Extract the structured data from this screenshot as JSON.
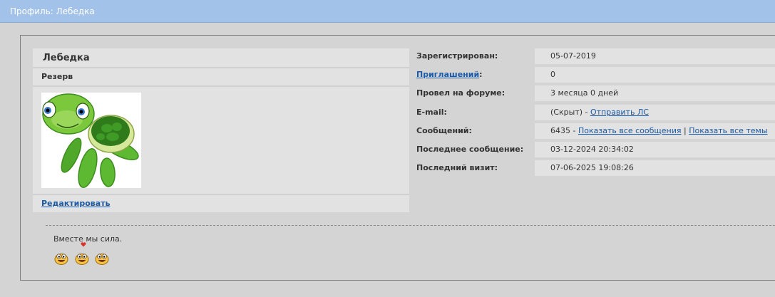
{
  "titlebar": {
    "title": "Профиль: Лебедка"
  },
  "profile": {
    "name": "Лебедка",
    "status": "Резерв",
    "edit_label": "Редактировать"
  },
  "stats": {
    "registered": {
      "label": "Зарегистрирован:",
      "value": "05-07-2019"
    },
    "invitations": {
      "label": "Приглашений",
      "colon": ":",
      "value": "0"
    },
    "time_on_forum": {
      "label": "Провел на форуме:",
      "value": "3 месяца 0 дней"
    },
    "email": {
      "label": "E-mail:",
      "value": "(Скрыт) - ",
      "send_pm": "Отправить ЛС"
    },
    "posts": {
      "label": "Сообщений:",
      "value": "6435 - ",
      "show_posts": "Показать все сообщения",
      "separator": " | ",
      "show_topics": "Показать все темы"
    },
    "last_post": {
      "label": "Последнее сообщение:",
      "value": "03-12-2024 20:34:02"
    },
    "last_visit": {
      "label": "Последний визит:",
      "value": "07-06-2025 19:08:26"
    }
  },
  "signature": {
    "text": "Вместе мы сила.",
    "smileys": [
      "smiley-icon",
      "smiley-icon",
      "smiley-icon"
    ]
  },
  "colors": {
    "titlebar_bg": "#a2c2ea",
    "link": "#1a5aa6",
    "background": "#d4d4d4",
    "panel": "#e1e2e1"
  }
}
